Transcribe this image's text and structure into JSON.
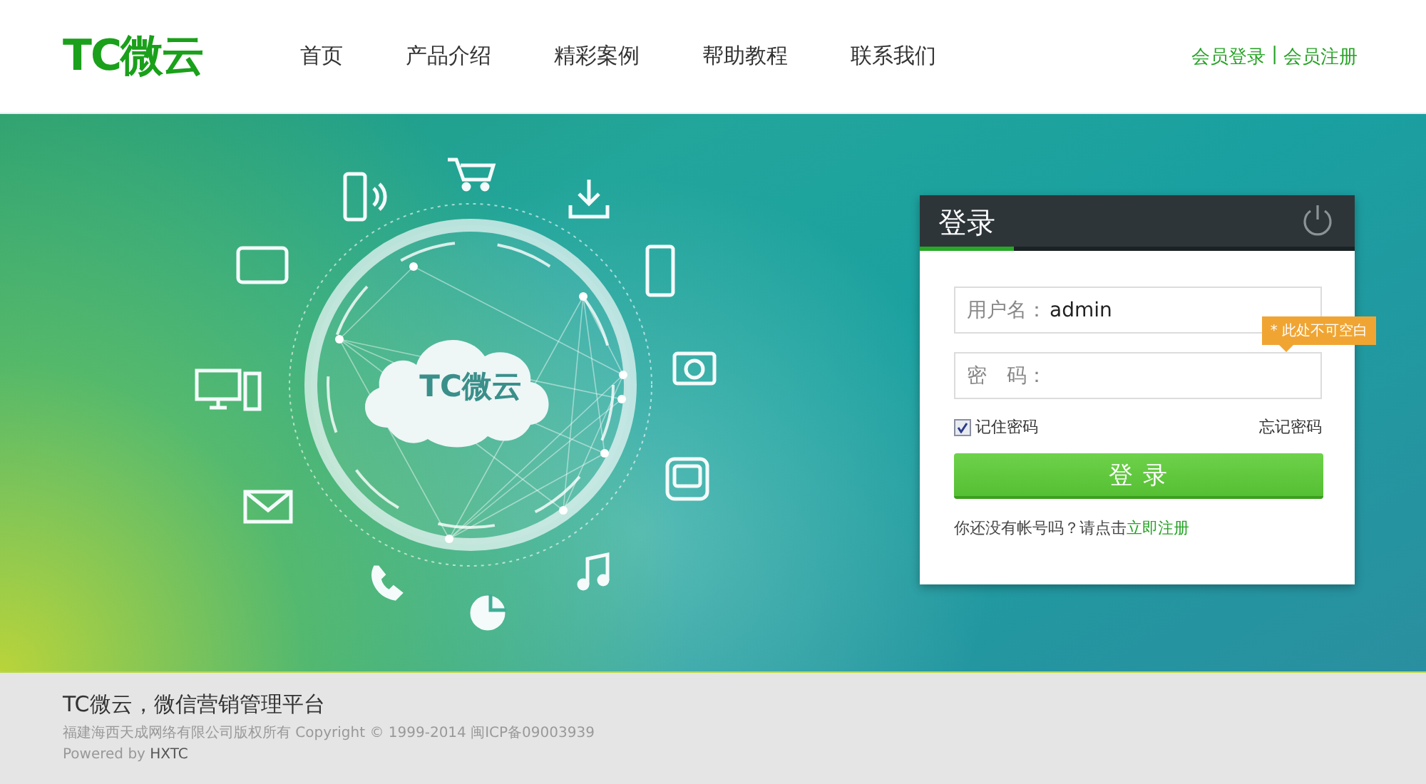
{
  "header": {
    "logo": "TC微云",
    "nav": [
      {
        "label": "首页"
      },
      {
        "label": "产品介绍"
      },
      {
        "label": "精彩案例"
      },
      {
        "label": "帮助教程"
      },
      {
        "label": "联系我们"
      }
    ],
    "member_links": [
      "会员登录",
      "会员注册"
    ],
    "separator": "|"
  },
  "hero": {
    "cloud_logo": "TC微云"
  },
  "login": {
    "title": "登录",
    "username": {
      "label": "用户名：",
      "value": "admin"
    },
    "password": {
      "label": "密　码："
    },
    "validation_tooltip": "* 此处不可空白",
    "remember": {
      "label": "记住密码",
      "checked": true
    },
    "forgot": "忘记密码",
    "submit": "登 录",
    "register_prompt": "你还没有帐号吗？请点击",
    "register_link": "立即注册"
  },
  "footer": {
    "title": "TC微云，微信营销管理平台",
    "copyright": "福建海西天成网络有限公司版权所有 Copyright © 1999-2014 闽ICP备09003939",
    "powered_prefix": "Powered by",
    "powered_brand": "HXTC"
  }
}
